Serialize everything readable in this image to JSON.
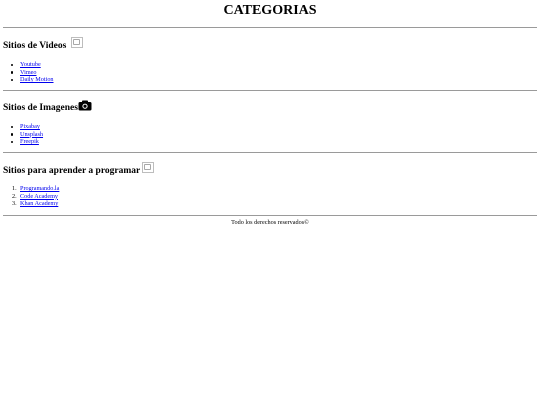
{
  "page": {
    "title": "CATEGORIAS"
  },
  "sections": [
    {
      "heading": "Sitios de Videos",
      "icon": "broken-image-icon",
      "links": [
        "Youtube",
        "Vimeo",
        "Daily Motion"
      ]
    },
    {
      "heading": "Sitios de Imagenes",
      "icon": "camera-icon",
      "links": [
        "Pixabay",
        "Unsplash",
        "Freepik"
      ]
    },
    {
      "heading": "Sitios para aprender a programar",
      "icon": "broken-image-icon",
      "links": [
        "Programando.la",
        "Code Academy",
        "Khan Academy"
      ]
    }
  ],
  "footer": {
    "text": "Todo los derechos reservados©"
  },
  "colors": {
    "link": "#0000ee",
    "rule": "#9a9a9a"
  }
}
